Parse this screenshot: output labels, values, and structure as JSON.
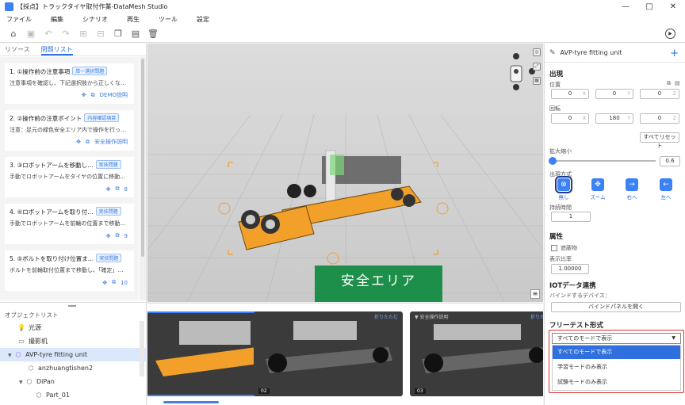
{
  "window": {
    "title": "【採点】トラックタイヤ取付作業-DataMesh Studio",
    "controls": [
      "—",
      "□",
      "✕"
    ]
  },
  "menu": [
    "ファイル",
    "編集",
    "シナリオ",
    "再生",
    "ツール",
    "設定"
  ],
  "left": {
    "tabs": [
      "リソース",
      "問題リスト"
    ],
    "questions": [
      {
        "title": "1. ①操作前の注意事項",
        "badge": "単一選択問題",
        "desc": "注意事項を確認し、下記選択肢から正しくな…",
        "link": "DEMO説明"
      },
      {
        "title": "2. ②操作前の注意ポイント",
        "badge": "内容確認項目",
        "desc": "注意：足元の緑色安全エリア内で操作を行っ…",
        "link": "安全操作説明"
      },
      {
        "title": "3. ③ロボットアームを移動し…",
        "badge": "実技問題",
        "desc": "手動でロボットアームをタイヤの位置に移動…",
        "link": "8"
      },
      {
        "title": "4. ④ロボットアームを取り付…",
        "badge": "実技問題",
        "desc": "手動でロボットアームを前輪の位置まで移動…",
        "link": "9"
      },
      {
        "title": "5. ⑤ボルトを取り付け位置ま…",
        "badge": "実技問題",
        "desc": "ボルトを前輪取付位置まで移動し、「確定」…",
        "link": "10"
      }
    ],
    "object_list_title": "オブジェクトリスト",
    "objects": [
      "光源",
      "撮影机",
      "AVP-tyre fitting unit",
      "anzhuangtishen2",
      "DiPan",
      "Part_01"
    ]
  },
  "viewport": {
    "safe_zone": "安全エリア"
  },
  "strip": {
    "cards": [
      {
        "label": "",
        "collapse": "",
        "num": ""
      },
      {
        "label": "",
        "collapse": "折りたたむ",
        "num": "02"
      },
      {
        "label": "▼ 安全操作説明",
        "collapse": "折りたたむ",
        "num": "03"
      }
    ]
  },
  "right": {
    "object_name": "AVP-tyre fitting unit",
    "appear": "出現",
    "position_label": "位置",
    "position": [
      "0",
      "0",
      "0"
    ],
    "rotation_label": "回転",
    "rotation": [
      "0",
      "180",
      "0"
    ],
    "axes": [
      "X",
      "Y",
      "Z"
    ],
    "reset": "すべてリセット",
    "scale_label": "拡大縮小",
    "scale_value": "0.6",
    "appear_mode_label": "出現方式",
    "modes": [
      "無し",
      "ズーム",
      "右へ",
      "左へ"
    ],
    "duration_label": "持続時間",
    "duration": "1",
    "attr": "属性",
    "occluder": "遮蔽物",
    "ratio_label": "表示比率",
    "ratio": "1.00000",
    "iot": "IOTデータ連携",
    "bind_label": "バインドするデバイス：",
    "bind_button": "バインドパネルを開く",
    "freetest": "フリーテスト形式",
    "dropdown_value": "すべてのモードで表示",
    "dropdown_options": [
      "すべてのモードで表示",
      "学習モードのみ表示",
      "試験モードのみ表示"
    ]
  },
  "colors": {
    "accent": "#2f6fde",
    "safe_zone": "#1e8f4a",
    "highlight_box": "#e03030"
  }
}
